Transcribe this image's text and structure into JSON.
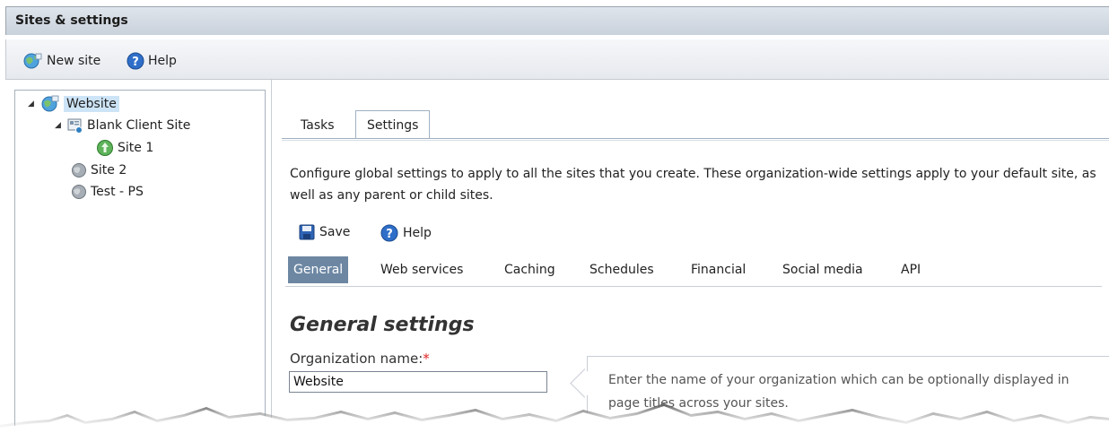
{
  "window": {
    "title": "Sites & settings"
  },
  "toolbar": {
    "new_site": "New site",
    "help": "Help"
  },
  "tree": {
    "root": "Website",
    "child": "Blank Client Site",
    "grandchild": "Site 1",
    "site2": "Site 2",
    "site3": "Test - PS"
  },
  "tabs": [
    {
      "label": "Tasks"
    },
    {
      "label": "Settings",
      "active": true
    }
  ],
  "description": "Configure global settings to apply to all the sites that you create. These organization-wide settings apply to your default site, as well as any parent or child sites.",
  "actions": {
    "save": "Save",
    "help": "Help"
  },
  "subnav": [
    "General",
    "Web services",
    "Caching",
    "Schedules",
    "Financial",
    "Social media",
    "API"
  ],
  "section": {
    "title": "General settings",
    "org_label": "Organization name:",
    "required_mark": "*",
    "org_value": "Website",
    "tip": "Enter the name of your organization which can be optionally displayed in page titles across your sites."
  },
  "colors": {
    "accent": "#6d87a3",
    "selection": "#cde4f7",
    "required": "#d22222"
  }
}
